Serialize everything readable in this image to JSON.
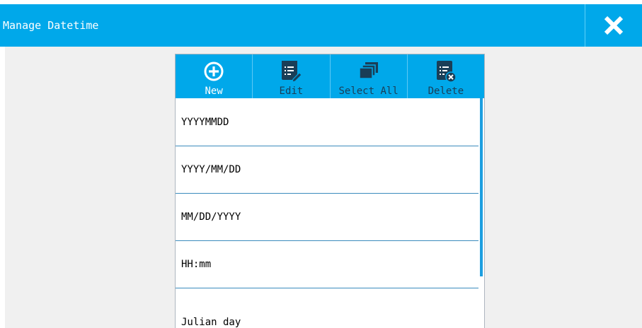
{
  "window": {
    "title": "Manage Datetime",
    "close_icon": "close-icon"
  },
  "toolbar": {
    "items": [
      {
        "label": "New",
        "icon": "plus-circle-icon",
        "active": true
      },
      {
        "label": "Edit",
        "icon": "edit-icon",
        "active": false
      },
      {
        "label": "Select All",
        "icon": "select-all-icon",
        "active": false
      },
      {
        "label": "Delete",
        "icon": "delete-icon",
        "active": false
      }
    ]
  },
  "list": {
    "items": [
      {
        "label": "YYYYMMDD"
      },
      {
        "label": "YYYY/MM/DD"
      },
      {
        "label": "MM/DD/YYYY"
      },
      {
        "label": "HH:mm"
      },
      {
        "label": "Julian day"
      }
    ]
  },
  "colors": {
    "accent": "#00a8ea",
    "inactive_label": "#1a3e57",
    "background": "#f0f0f0",
    "scrollbar": "#1c9ee0",
    "row_divider": "#3a8bbd"
  }
}
